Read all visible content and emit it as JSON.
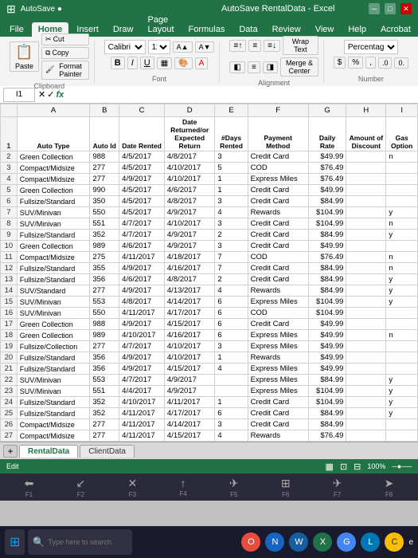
{
  "titlebar": {
    "title": "AutoSave  RentalData - Excel",
    "tabs": [
      "File",
      "Home",
      "Insert",
      "Draw",
      "Page Layout",
      "Formulas",
      "Data",
      "Review",
      "View",
      "Help",
      "Acrobat"
    ]
  },
  "ribbon": {
    "active_tab": "Home",
    "clipboard": {
      "label": "Clipboard",
      "cut": "Cut",
      "copy": "Copy",
      "format_painter": "Format Painter"
    },
    "font": {
      "label": "Font",
      "name": "Calibri",
      "size": "11",
      "bold": "B",
      "italic": "I",
      "underline": "U"
    },
    "alignment": {
      "label": "Alignment",
      "wrap_text": "Wrap Text",
      "merge_center": "Merge & Center"
    },
    "number": {
      "label": "Number",
      "format": "Percentage",
      "dollar": "$",
      "percent": "%"
    }
  },
  "formula_bar": {
    "cell_ref": "I1",
    "formula": "fx"
  },
  "columns": {
    "letters": [
      "",
      "A",
      "B",
      "C",
      "D",
      "E",
      "F",
      "G",
      "H",
      "I"
    ],
    "headers": {
      "A": "Auto Type",
      "B": "Auto Id",
      "C": "Date Rented",
      "D": "Date Returned/or\nExpected Return",
      "E": "#Days Rented",
      "F": "Payment\nMethod",
      "G": "Daily Rate",
      "H": "Amount of\nDiscount",
      "I": "Gas Option"
    }
  },
  "rows": [
    {
      "num": 1,
      "A": "Auto Type",
      "B": "Auto Id",
      "C": "Date Rented",
      "D": "Date Returned/or\nExpected Return",
      "E": "#Days Rented",
      "F": "Payment\nMethod",
      "G": "Daily Rate",
      "H": "Amount of\nDiscount",
      "I": "Gas Option",
      "is_header": true
    },
    {
      "num": 2,
      "A": "Green Collection",
      "B": "988",
      "C": "4/5/2017",
      "D": "4/8/2017",
      "E": "3",
      "F": "Credit Card",
      "G": "$49.99",
      "H": "",
      "I": "n"
    },
    {
      "num": 3,
      "A": "Compact/Midsize",
      "B": "277",
      "C": "4/5/2017",
      "D": "4/10/2017",
      "E": "5",
      "F": "COD",
      "G": "$76.49",
      "H": "",
      "I": ""
    },
    {
      "num": 4,
      "A": "Compact/Midsize",
      "B": "277",
      "C": "4/9/2017",
      "D": "4/10/2017",
      "E": "1",
      "F": "Express Miles",
      "G": "$76.49",
      "H": "",
      "I": ""
    },
    {
      "num": 5,
      "A": "Green Collection",
      "B": "990",
      "C": "4/5/2017",
      "D": "4/6/2017",
      "E": "1",
      "F": "Credit Card",
      "G": "$49.99",
      "H": "",
      "I": ""
    },
    {
      "num": 6,
      "A": "Fullsize/Standard",
      "B": "350",
      "C": "4/5/2017",
      "D": "4/8/2017",
      "E": "3",
      "F": "Credit Card",
      "G": "$84.99",
      "H": "",
      "I": ""
    },
    {
      "num": 7,
      "A": "SUV/Minivan",
      "B": "550",
      "C": "4/5/2017",
      "D": "4/9/2017",
      "E": "4",
      "F": "Rewards",
      "G": "$104.99",
      "H": "",
      "I": "y"
    },
    {
      "num": 8,
      "A": "SUV/Minivan",
      "B": "551",
      "C": "4/7/2017",
      "D": "4/10/2017",
      "E": "3",
      "F": "Credit Card",
      "G": "$104.99",
      "H": "",
      "I": "n"
    },
    {
      "num": 9,
      "A": "Fullsize/Standard",
      "B": "352",
      "C": "4/7/2017",
      "D": "4/9/2017",
      "E": "2",
      "F": "Credit Card",
      "G": "$84.99",
      "H": "",
      "I": "y"
    },
    {
      "num": 10,
      "A": "Green Collection",
      "B": "989",
      "C": "4/6/2017",
      "D": "4/9/2017",
      "E": "3",
      "F": "Credit Card",
      "G": "$49.99",
      "H": "",
      "I": ""
    },
    {
      "num": 11,
      "A": "Compact/Midsize",
      "B": "275",
      "C": "4/11/2017",
      "D": "4/18/2017",
      "E": "7",
      "F": "COD",
      "G": "$76.49",
      "H": "",
      "I": "n"
    },
    {
      "num": 12,
      "A": "Fullsize/Standard",
      "B": "355",
      "C": "4/9/2017",
      "D": "4/16/2017",
      "E": "7",
      "F": "Credit Card",
      "G": "$84.99",
      "H": "",
      "I": "n"
    },
    {
      "num": 13,
      "A": "Fullsize/Standard",
      "B": "356",
      "C": "4/6/2017",
      "D": "4/8/2017",
      "E": "2",
      "F": "Credit Card",
      "G": "$84.99",
      "H": "",
      "I": "y"
    },
    {
      "num": 14,
      "A": "SUV/Standard",
      "B": "277",
      "C": "4/9/2017",
      "D": "4/13/2017",
      "E": "4",
      "F": "Rewards",
      "G": "$84.99",
      "H": "",
      "I": "y"
    },
    {
      "num": 15,
      "A": "SUV/Minivan",
      "B": "553",
      "C": "4/8/2017",
      "D": "4/14/2017",
      "E": "6",
      "F": "Express Miles",
      "G": "$104.99",
      "H": "",
      "I": "y"
    },
    {
      "num": 16,
      "A": "SUV/Minivan",
      "B": "550",
      "C": "4/11/2017",
      "D": "4/17/2017",
      "E": "6",
      "F": "COD",
      "G": "$104.99",
      "H": "",
      "I": ""
    },
    {
      "num": 17,
      "A": "Green Collection",
      "B": "988",
      "C": "4/9/2017",
      "D": "4/15/2017",
      "E": "6",
      "F": "Credit Card",
      "G": "$49.99",
      "H": "",
      "I": ""
    },
    {
      "num": 18,
      "A": "Green Collection",
      "B": "989",
      "C": "4/10/2017",
      "D": "4/16/2017",
      "E": "6",
      "F": "Express Miles",
      "G": "$49.99",
      "H": "",
      "I": "n"
    },
    {
      "num": 19,
      "A": "Fullsize/Collection",
      "B": "277",
      "C": "4/7/2017",
      "D": "4/10/2017",
      "E": "3",
      "F": "Express Miles",
      "G": "$49.99",
      "H": "",
      "I": ""
    },
    {
      "num": 20,
      "A": "Fullsize/Standard",
      "B": "356",
      "C": "4/9/2017",
      "D": "4/10/2017",
      "E": "1",
      "F": "Rewards",
      "G": "$49.99",
      "H": "",
      "I": ""
    },
    {
      "num": 21,
      "A": "Fullsize/Standard",
      "B": "356",
      "C": "4/9/2017",
      "D": "4/15/2017",
      "E": "4",
      "F": "Express Miles",
      "G": "$49.99",
      "H": "",
      "I": ""
    },
    {
      "num": 22,
      "A": "SUV/Minivan",
      "B": "553",
      "C": "4/7/2017",
      "D": "4/9/2017",
      "E": "",
      "F": "Express Miles",
      "G": "$84.99",
      "H": "",
      "I": "y"
    },
    {
      "num": 23,
      "A": "SUV/Minivan",
      "B": "551",
      "C": "4/4/2017",
      "D": "4/9/2017",
      "E": "",
      "F": "Express Miles",
      "G": "$104.99",
      "H": "",
      "I": "y"
    },
    {
      "num": 24,
      "A": "Fullsize/Standard",
      "B": "352",
      "C": "4/10/2017",
      "D": "4/11/2017",
      "E": "1",
      "F": "Credit Card",
      "G": "$104.99",
      "H": "",
      "I": "y"
    },
    {
      "num": 25,
      "A": "Fullsize/Standard",
      "B": "352",
      "C": "4/11/2017",
      "D": "4/17/2017",
      "E": "6",
      "F": "Credit Card",
      "G": "$84.99",
      "H": "",
      "I": "y"
    },
    {
      "num": 26,
      "A": "Compact/Midsize",
      "B": "277",
      "C": "4/11/2017",
      "D": "4/14/2017",
      "E": "3",
      "F": "Credit Card",
      "G": "$84.99",
      "H": "",
      "I": ""
    },
    {
      "num": 27,
      "A": "Compact/Midsize",
      "B": "277",
      "C": "4/11/2017",
      "D": "4/15/2017",
      "E": "4",
      "F": "Rewards",
      "G": "$76.49",
      "H": "",
      "I": ""
    }
  ],
  "sheet_tabs": [
    "RentalData",
    "ClientData"
  ],
  "status_bar": {
    "ready": "Edit",
    "sheet": "RentalData"
  },
  "taskbar": {
    "search_placeholder": "Type here to search",
    "time": "e"
  },
  "function_keys": [
    {
      "label": "F1",
      "icon": "⬅"
    },
    {
      "label": "F2",
      "icon": "↙"
    },
    {
      "label": "F3",
      "icon": "✕"
    },
    {
      "label": "F4",
      "icon": "↑"
    },
    {
      "label": "F5",
      "icon": "✈"
    },
    {
      "label": "F6",
      "icon": "⊞"
    },
    {
      "label": "F7",
      "icon": "✈"
    },
    {
      "label": "F8",
      "icon": "➤"
    }
  ]
}
